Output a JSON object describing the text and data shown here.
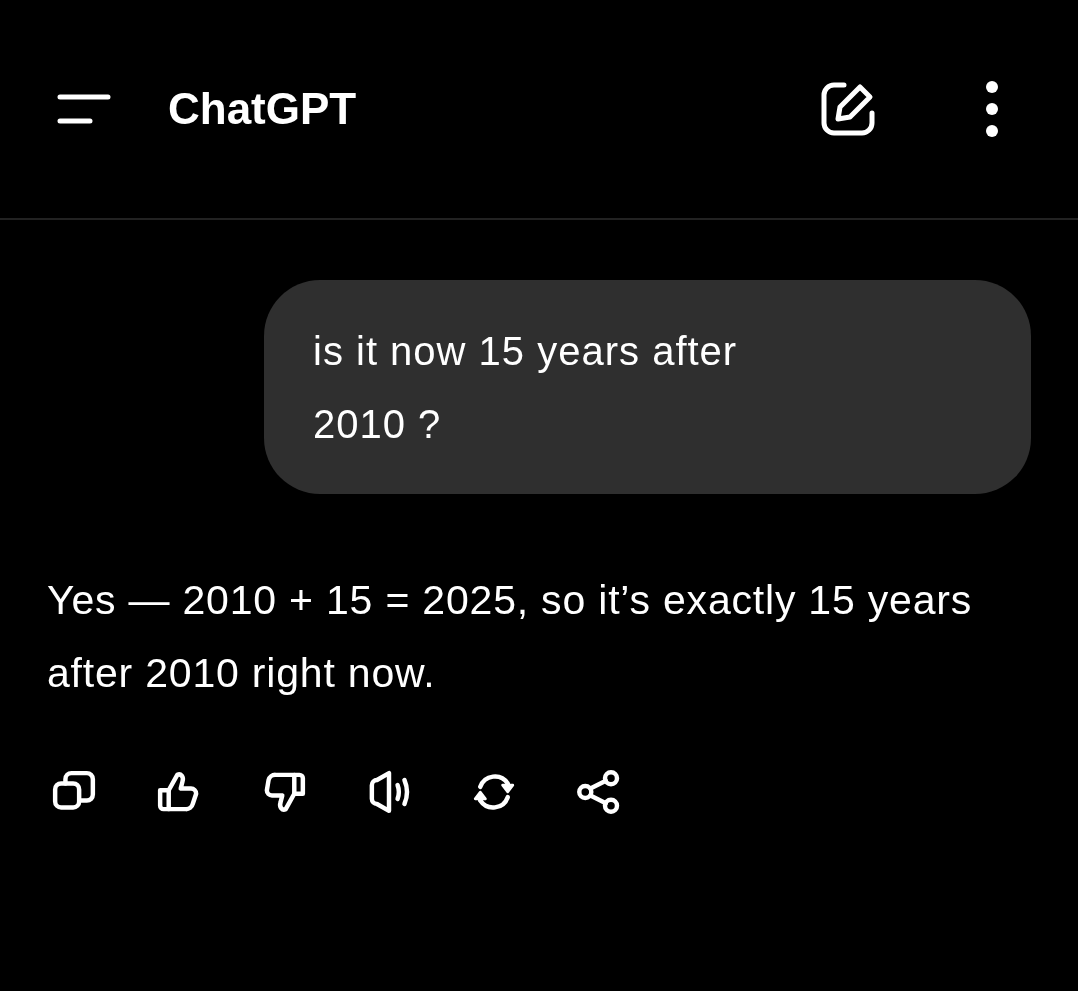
{
  "header": {
    "title": "ChatGPT"
  },
  "messages": [
    {
      "kind": "user",
      "text": "is it now 15 years after 2010 ?"
    },
    {
      "kind": "assistant",
      "text": "Yes — 2010 + 15 = 2025, so it’s exactly 15 years after 2010 right now."
    }
  ]
}
